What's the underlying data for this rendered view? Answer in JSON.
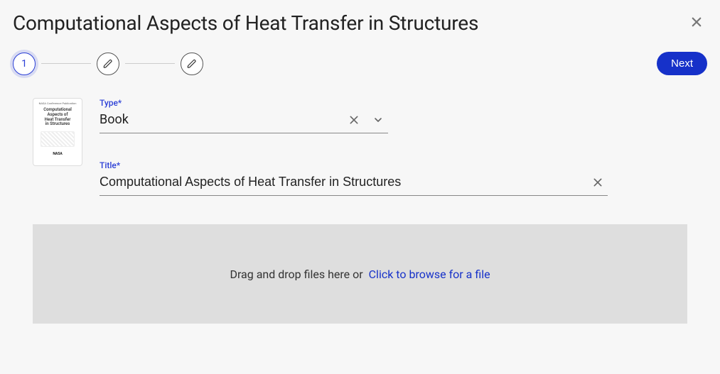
{
  "header": {
    "title": "Computational Aspects of Heat Transfer in Structures"
  },
  "stepper": {
    "current_label": "1",
    "next_button": "Next"
  },
  "thumbnail": {
    "top_line": "NASA Conference Publication",
    "title_l1": "Computational",
    "title_l2": "Aspects of",
    "title_l3": "Heat Transfer",
    "title_l4": "in Structures",
    "logo": "NASA"
  },
  "fields": {
    "type": {
      "label": "Type",
      "required_mark": "*",
      "value": "Book"
    },
    "title": {
      "label": "Title",
      "required_mark": "*",
      "value": "Computational Aspects of Heat Transfer in Structures"
    }
  },
  "dropzone": {
    "text": "Drag and drop files here or",
    "browse": "Click to browse for a file"
  }
}
